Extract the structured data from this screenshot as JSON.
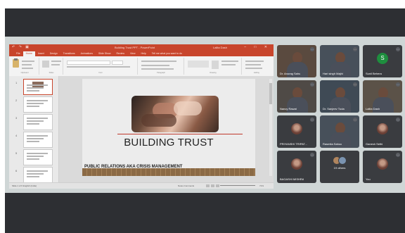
{
  "ppt": {
    "doc_title": "Building Trust PPT - PowerPoint",
    "user": "Lalita Dash",
    "quick_access": "↶ ↷ ▣",
    "window_controls": "– □ ✕",
    "tabs": [
      "File",
      "Home",
      "Insert",
      "Design",
      "Transitions",
      "Animations",
      "Slide Show",
      "Review",
      "View",
      "Help",
      "Tell me what you want to do"
    ],
    "ribbon_groups": [
      "Clipboard",
      "Slides",
      "Font",
      "Paragraph",
      "Drawing",
      "Editing"
    ],
    "slide": {
      "title": "BUILDING TRUST",
      "subtitle": "PUBLIC RELATIONS AKA CRISIS MANAGEMENT"
    },
    "thumbnail_numbers": [
      "1",
      "2",
      "3",
      "4",
      "5",
      "6"
    ],
    "status": {
      "left": "Slide 1 of 6   English (India)",
      "notes": "Notes   Comments",
      "zoom": "71%"
    }
  },
  "participants": [
    {
      "name": "Dr. Anurag Sahu",
      "type": "video"
    },
    {
      "name": "Hari singh Majhi",
      "type": "video"
    },
    {
      "name": "Sunil Behera",
      "type": "avatar",
      "initial": "S",
      "color": "#1e8e3e"
    },
    {
      "name": "Nancy Rawat",
      "type": "video"
    },
    {
      "name": "Dr. Sanjeev Tuda",
      "type": "video"
    },
    {
      "name": "Lalita Dash",
      "type": "video"
    },
    {
      "name": "PRIYANSHI TRIPAT...",
      "type": "photo"
    },
    {
      "name": "Rasmita Sahoo",
      "type": "video"
    },
    {
      "name": "Ganesh Sethi",
      "type": "photo"
    },
    {
      "name": "BAGASHI MISHRA",
      "type": "photo"
    },
    {
      "name": "19 others",
      "type": "others"
    },
    {
      "name": "You",
      "type": "photo"
    }
  ],
  "colors": {
    "ppt_accent": "#c8452c",
    "meet_bg": "#2d2f33"
  }
}
